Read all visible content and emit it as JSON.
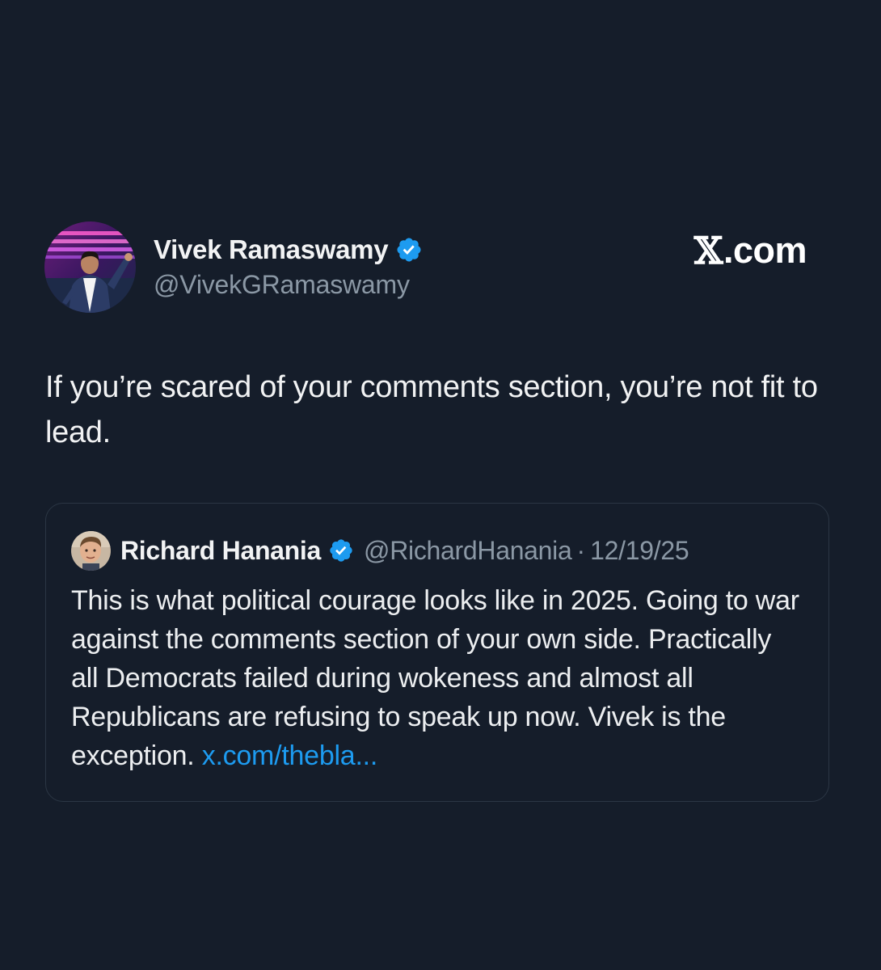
{
  "brand": {
    "x_letter": "𝕏",
    "label": ".com"
  },
  "author": {
    "name": "Vivek Ramaswamy",
    "handle": "@VivekGRamaswamy",
    "verified": true,
    "avatar_icon": "profile-photo"
  },
  "post": {
    "text": "If you’re scared of your comments section, you’re not fit to lead."
  },
  "quote": {
    "author_name": "Richard Hanania",
    "handle": "@RichardHanania",
    "separator": "·",
    "date": "12/19/25",
    "verified": true,
    "text": "This is what political courage looks like in 2025. Going to war against the comments section of your own side. Practically all Democrats failed during wokeness and almost all Republicans are refusing to speak up now. Vivek is the exception.",
    "link_text": "x.com/thebla..."
  },
  "colors": {
    "background": "#151d2a",
    "verified_badge": "#1d9bf0",
    "link": "#1d9bf0",
    "secondary_text": "#8b98a5"
  }
}
